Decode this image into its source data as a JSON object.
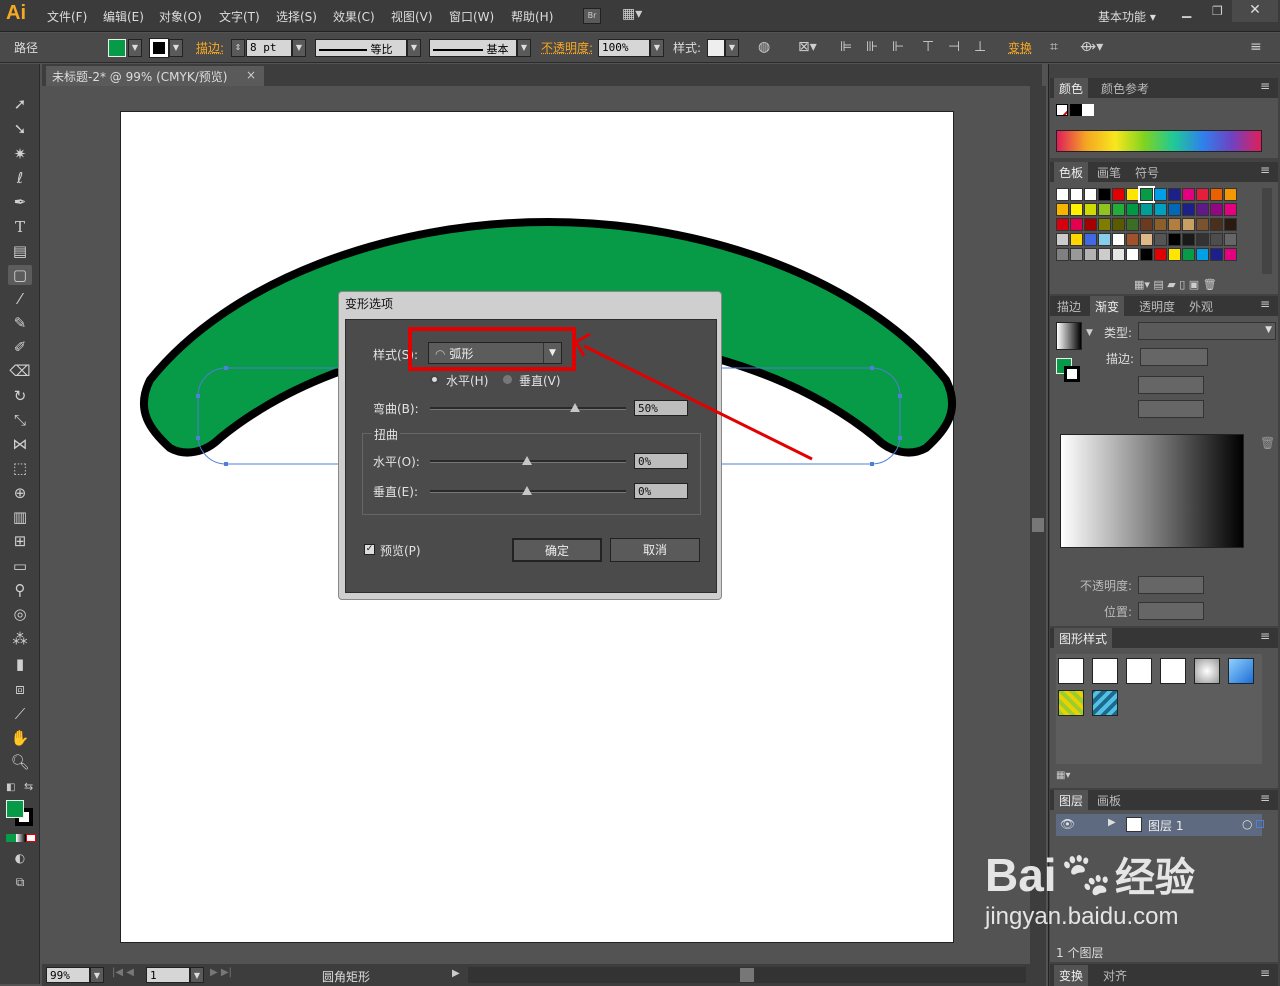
{
  "app": {
    "logo": "Ai",
    "workspace": "基本功能"
  },
  "menu": [
    "文件(F)",
    "编辑(E)",
    "对象(O)",
    "文字(T)",
    "选择(S)",
    "效果(C)",
    "视图(V)",
    "窗口(W)",
    "帮助(H)"
  ],
  "menu_extra": {
    "bridge": "Br"
  },
  "control": {
    "object_type": "路径",
    "stroke_label": "描边:",
    "stroke_value": "8 pt",
    "profile_uniform": "等比",
    "brush_basic": "基本",
    "opacity_label": "不透明度:",
    "opacity_value": "100%",
    "style_label": "样式:",
    "transform_label": "变换"
  },
  "doc_tab": "未标题-2* @ 99% (CMYK/预览)",
  "status": {
    "zoom": "99%",
    "page": "1",
    "tool_name": "圆角矩形"
  },
  "dialog": {
    "title": "变形选项",
    "style_label": "样式(S):",
    "style_value": "弧形",
    "horizontal": "水平(H)",
    "vertical": "垂直(V)",
    "bend_label": "弯曲(B):",
    "bend_value": "50%",
    "distortion_label": "扭曲",
    "dist_h_label": "水平(O):",
    "dist_h_value": "0%",
    "dist_v_label": "垂直(E):",
    "dist_v_value": "0%",
    "preview_label": "预览(P)",
    "ok": "确定",
    "cancel": "取消"
  },
  "panels": {
    "color_tabs": [
      "颜色",
      "颜色参考"
    ],
    "swatch_tabs": [
      "色板",
      "画笔",
      "符号"
    ],
    "gradient_tabs": [
      "描边",
      "渐变",
      "透明度",
      "外观"
    ],
    "gradient_type_label": "类型:",
    "gradient_stroke_label": "描边:",
    "gradient_opacity_label": "不透明度:",
    "gradient_position_label": "位置:",
    "graphic_styles_tab": "图形样式",
    "layers_tabs": [
      "图层",
      "画板"
    ],
    "layer_name": "图层 1",
    "layer_count": "1 个图层",
    "bottom_tabs": [
      "变换",
      "对齐"
    ]
  },
  "watermark": {
    "brand": "Bai",
    "brand2": "经验",
    "url": "jingyan.baidu.com"
  },
  "colors": {
    "fill_green": "#079a47",
    "highlight_red": "#e30000",
    "accent_orange": "#f7a823"
  }
}
